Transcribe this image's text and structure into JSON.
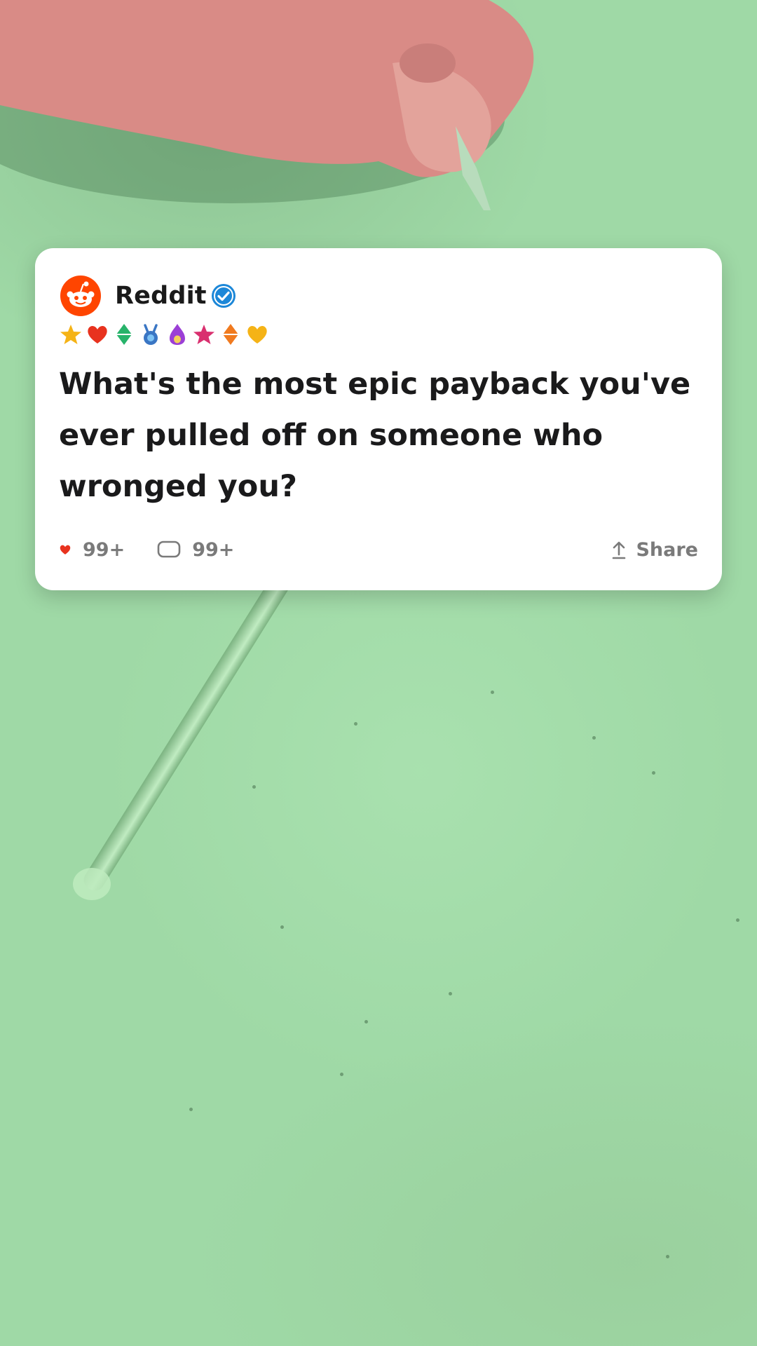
{
  "post": {
    "author": "Reddit",
    "verified_icon": "verified-check-icon",
    "awards": [
      "star",
      "heart",
      "diamond",
      "rabbit",
      "flame",
      "pink-star",
      "orange-diamond",
      "gold-heart"
    ],
    "title": "What's the most epic payback you've ever pulled off on someone who wronged you?",
    "likes": "99+",
    "comments": "99+",
    "share_label": "Share"
  },
  "colors": {
    "reddit_orange": "#ff4500",
    "verified_blue": "#1c87d8",
    "heart_red": "#e8321e",
    "background_green": "#9fd9a6"
  }
}
